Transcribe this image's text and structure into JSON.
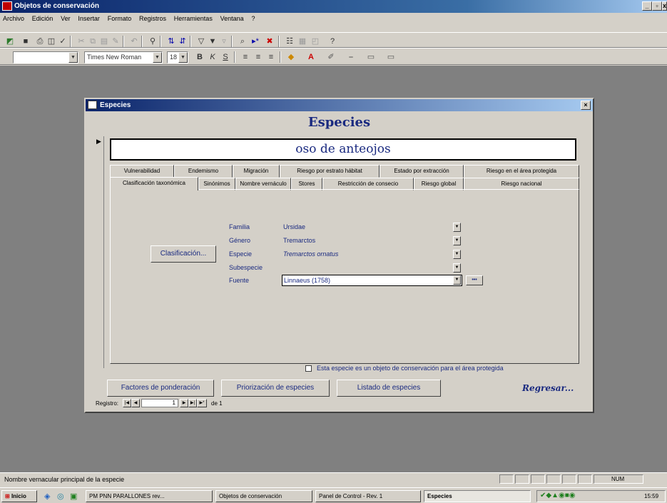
{
  "app": {
    "title": "Objetos de conservación",
    "window_controls": [
      "_",
      "▫",
      "x"
    ]
  },
  "menu": [
    "Archivo",
    "Edición",
    "Ver",
    "Insertar",
    "Formato",
    "Registros",
    "Herramientas",
    "Ventana",
    "?"
  ],
  "formatting": {
    "font": "Times New Roman",
    "size": "18"
  },
  "form": {
    "window_title": "Especies",
    "heading": "Especies",
    "species_name": "oso de anteojos",
    "tabs_row1": [
      "Vulnerabilidad",
      "Endemismo",
      "Migración",
      "Riesgo por estrato hábitat",
      "Estado por extracción",
      "Riesgo en el área protegida"
    ],
    "tabs_row2": [
      "Clasificación taxonómica",
      "Sinónimos",
      "Nombre vernáculo",
      "Stores",
      "Restricción de consecio",
      "Riesgo global",
      "Riesgo nacional"
    ],
    "active_tab": "Clasificación taxonómica",
    "classify_button": "Clasificación...",
    "fields": [
      {
        "label": "Familia",
        "value": "Ursidae"
      },
      {
        "label": "Género",
        "value": "Tremarctos"
      },
      {
        "label": "Especie",
        "value": "Tremarctos ornatus"
      },
      {
        "label": "Subespecie",
        "value": ""
      },
      {
        "label": "Fuente",
        "value": "Linnaeus (1758)"
      }
    ],
    "ellipsis_button": "•••",
    "checkbox_label": "Esta especie es un objeto de conservación para el área protegida",
    "buttons": {
      "weights": "Factores de ponderación",
      "prioritize": "Priorización de especies",
      "list": "Listado de especies",
      "back": "Regresar..."
    },
    "record_nav": {
      "label": "Registro:",
      "current": "1",
      "of": "de 1"
    }
  },
  "status": {
    "text": "Nombre vernacular principal de la especie",
    "mode": "NUM"
  },
  "taskbar": {
    "start": "Inicio",
    "tasks": [
      "PM PNN PARALLONES rev...",
      "Objetos de conservación",
      "Panel de Control - Rev. 1",
      "Especies"
    ],
    "time": "15:59"
  }
}
